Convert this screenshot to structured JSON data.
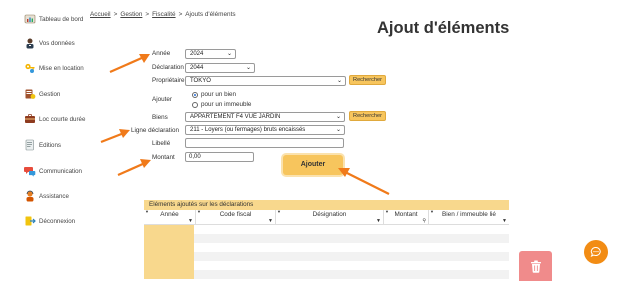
{
  "sidebar": {
    "items": [
      {
        "label": "Tableau de bord",
        "icon": "dashboard-icon"
      },
      {
        "label": "Vos données",
        "icon": "user-data-icon"
      },
      {
        "label": "Mise en location",
        "icon": "rental-keys-icon"
      },
      {
        "label": "Gestion",
        "icon": "management-icon"
      },
      {
        "label": "Loc courte durée",
        "icon": "short-term-rental-icon"
      },
      {
        "label": "Editions",
        "icon": "editions-icon"
      },
      {
        "label": "Communication",
        "icon": "communication-icon"
      },
      {
        "label": "Assistance",
        "icon": "assistance-icon"
      },
      {
        "label": "Déconnexion",
        "icon": "logout-icon"
      }
    ]
  },
  "breadcrumb": {
    "home": "Accueil",
    "management": "Gestion",
    "tax": "Fiscalité",
    "current": "Ajouts d'éléments",
    "separator": ">"
  },
  "page": {
    "title": "Ajout d'éléments"
  },
  "form": {
    "year": {
      "label": "Année",
      "value": "2024"
    },
    "declaration": {
      "label": "Déclaration",
      "value": "2044"
    },
    "owner": {
      "label": "Propriétaire",
      "value": "TOKYO",
      "search_label": "Rechercher"
    },
    "add": {
      "label": "Ajouter",
      "options": [
        "pour un bien",
        "pour un immeuble"
      ],
      "selected": "pour un bien"
    },
    "property": {
      "label": "Biens",
      "value": "APPARTEMENT F4 VUE JARDIN",
      "search_label": "Rechercher"
    },
    "declaration_line": {
      "label": "Ligne déclaration",
      "value": "211 - Loyers (ou fermages) bruts encaissés"
    },
    "wording": {
      "label": "Libellé",
      "value": ""
    },
    "amount": {
      "label": "Montant",
      "value": "0,00"
    },
    "submit_label": "Ajouter"
  },
  "table": {
    "title": "Eléments ajoutés sur les déclarations",
    "columns": [
      "Année",
      "Code fiscal",
      "Désignation",
      "Montant",
      "Bien / immeuble lié"
    ]
  },
  "colors": {
    "accent": "#f7c55d",
    "table_header": "#f8d88d",
    "arrow": "#f07a1a",
    "chat": "#f28c14",
    "delete": "#f08b8b"
  },
  "icons": {
    "chat": "chat-bubble-icon",
    "delete": "trash-icon"
  }
}
